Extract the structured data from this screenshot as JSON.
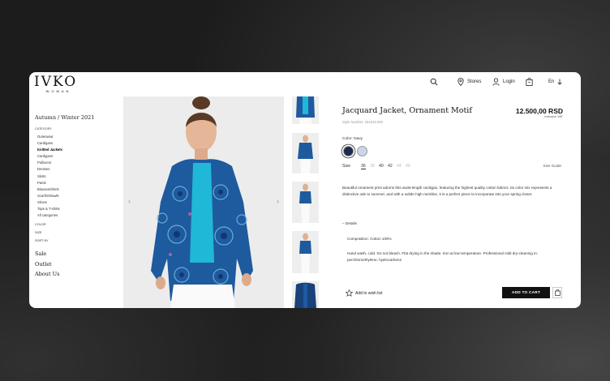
{
  "brand": {
    "name": "IVKO",
    "sub": "WOMAN"
  },
  "header": {
    "search_icon": "search-icon",
    "stores_label": "Stores",
    "login_label": "Login",
    "language_label": "En"
  },
  "nav": {
    "season": "Autumn / Winter 2021",
    "category_heading": "CATEGORY",
    "categories": [
      "Outerwear",
      "Cardigans",
      "Knitted Jackets",
      "Cardigans",
      "Pullovers",
      "Dresses",
      "Skirts",
      "Pants",
      "Blouses/Shirts",
      "Scarfs/Shawls",
      "Shoes",
      "Tops & T-shirts",
      "All categories"
    ],
    "active_category": "Knitted Jackets",
    "filters": [
      "COLOR",
      "SIZE",
      "SORT BY"
    ],
    "links": [
      "Sale",
      "Outlet",
      "About Us"
    ]
  },
  "product": {
    "title": "Jacquard Jacket, Ornament Motif",
    "price": "12.500,00 RSD",
    "vat": "Inclusive VAT",
    "style_number": "Style Number: 221515.039",
    "color_label": "Color: Navy",
    "swatches": [
      {
        "name": "Navy",
        "color": "#1f2a4a",
        "selected": true
      },
      {
        "name": "Light Blue",
        "color": "#c9d6ea",
        "selected": false
      }
    ],
    "size_label": "Size",
    "sizes": [
      {
        "label": "36",
        "state": "selected"
      },
      {
        "label": "38",
        "state": "unavailable"
      },
      {
        "label": "40",
        "state": "available"
      },
      {
        "label": "42",
        "state": "available"
      },
      {
        "label": "44",
        "state": "unavailable"
      },
      {
        "label": "46",
        "state": "unavailable"
      }
    ],
    "size_guide": "Size Guide",
    "description": "Beautiful ornament print adorns this waist-length cardigan, featuring the highest quality cotton fabrics. Its color mix represents a distinctive ode to summer, and with a subtle high neckline, it is a perfect piece to incorporate into your spring closet.",
    "details_label": "– Details",
    "composition": "Composition: Cotton 100%",
    "care": "Hand wash, cold. Do not bleach. Flat drying in the shade. Iron at low temperature. Professional mild dry-cleaning in: perchloroethylene, hydrocarbons",
    "wishlist_label": "Add to wish list",
    "cart_label": "ADD TO CART"
  },
  "colors": {
    "accent": "#111111",
    "jacket": "#1e5a9e",
    "top": "#1fb8d6"
  }
}
